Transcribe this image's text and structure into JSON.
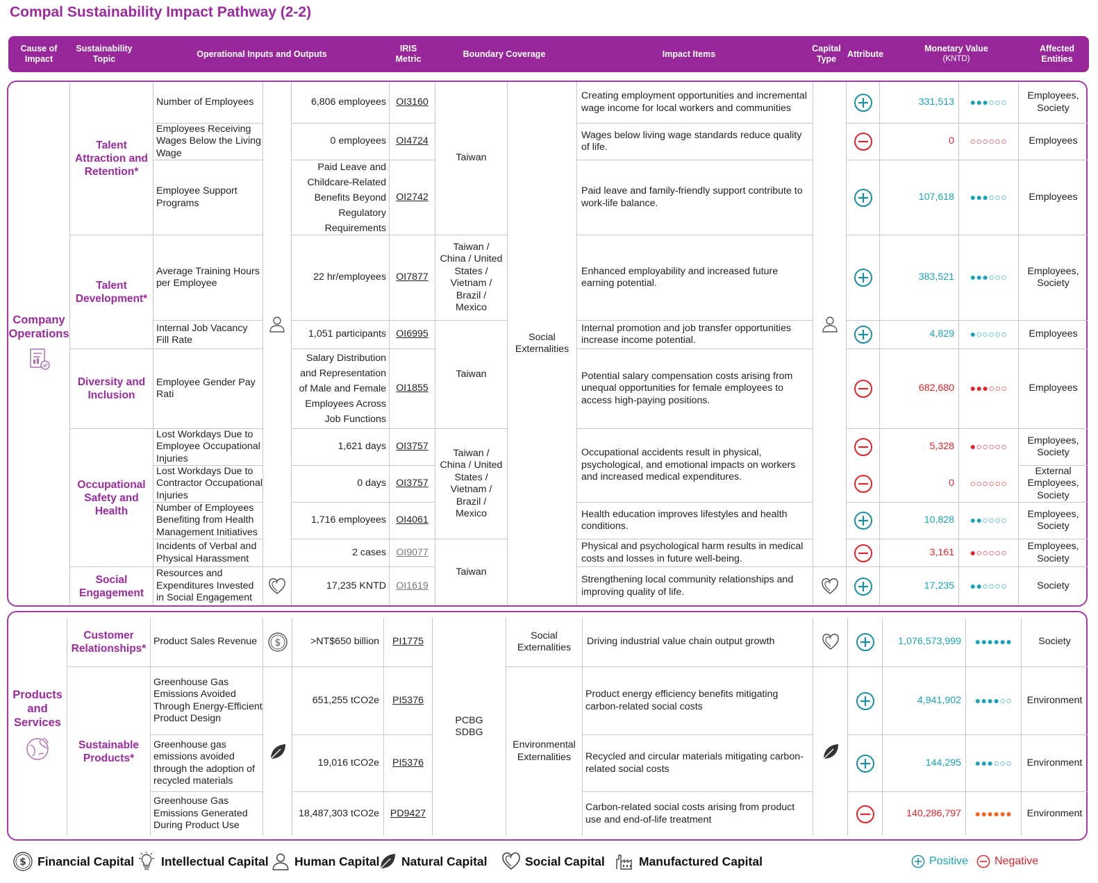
{
  "title": "Compal Sustainability Impact Pathway (2-2)",
  "header": {
    "cause": "Cause of Impact",
    "topic": "Sustainability Topic",
    "inputs": "Operational Inputs and Outputs",
    "iris": "IRIS Metric",
    "boundary": "Boundary Coverage",
    "impact": "Impact Items",
    "capital": "Capital Type",
    "attribute": "Attribute",
    "monetary": "Monetary Value",
    "monetary_unit": "(KNTD)",
    "affected": "Affected Entities"
  },
  "section1": {
    "cause": "Company Operations",
    "externality": "Social Externalities",
    "topics": {
      "talent": "Talent Attraction and Retention*",
      "development": "Talent Development*",
      "diversity": "Diversity and Inclusion",
      "safety": "Occupational Safety and Health",
      "social": "Social Engagement"
    },
    "boundaries": {
      "taiwan1": "Taiwan",
      "multi1": "Taiwan / China / United States / Vietnam / Brazil / Mexico",
      "taiwan2": "Taiwan",
      "multi2": "Taiwan / China / United States / Vietnam / Brazil / Mexico",
      "taiwan3": "Taiwan"
    },
    "rows": [
      {
        "metric": "Number of Employees",
        "value": "6,806 employees",
        "iris": "OI3160",
        "impact": "Creating employment opportunities and incremental wage income for local workers and communities",
        "money": "331,513",
        "dots": "●●●○○○",
        "affected": "Employees, Society"
      },
      {
        "metric": "Employees Receiving Wages Below the Living Wage",
        "value": "0 employees",
        "iris": "OI4724",
        "impact": "Wages below living wage standards reduce quality of life.",
        "money": "0",
        "dots": "○○○○○○",
        "affected": "Employees"
      },
      {
        "metric": "Employee Support Programs",
        "value": "Paid Leave and Childcare-Related Benefits Beyond Regulatory Requirements",
        "iris": "OI2742",
        "impact": "Paid leave and family-friendly support contribute to work-life balance.",
        "money": "107,618",
        "dots": "●●●○○○",
        "affected": "Employees"
      },
      {
        "metric": "Average Training Hours per Employee",
        "value": "22 hr/employees",
        "iris": "OI7877",
        "impact": "Enhanced employability and increased future earning potential.",
        "money": "383,521",
        "dots": "●●●○○○",
        "affected": "Employees, Society"
      },
      {
        "metric": "Internal Job Vacancy Fill Rate",
        "value": "1,051 participants",
        "iris": "OI6995",
        "impact": "Internal promotion and job transfer opportunities increase income potential.",
        "money": "4,829",
        "dots": "●○○○○○",
        "affected": "Employees"
      },
      {
        "metric": "Employee Gender Pay Rati",
        "value": "Salary Distribution and Representation of Male and Female Employees Across Job Functions",
        "iris": "OI1855",
        "impact": "Potential salary compensation costs arising from unequal opportunities for female employees to access high-paying positions.",
        "money": "682,680",
        "dots": "●●●○○○",
        "affected": "Employees"
      },
      {
        "metric": "Lost Workdays Due to Employee Occupational Injuries",
        "value": "1,621 days",
        "iris": "OI3757",
        "money": "5,328",
        "dots": "●○○○○○",
        "affected": "Employees, Society"
      },
      {
        "metric": "Lost Workdays Due to Contractor Occupational Injuries",
        "value": "0 days",
        "iris": "OI3757",
        "money": "0",
        "dots": "○○○○○○",
        "affected": "External Employees, Society"
      },
      {
        "metric": "Number of Employees Benefiting from Health Management Initiatives",
        "value": "1,716 employees",
        "iris": "OI4061",
        "impact": "Health education improves lifestyles and health conditions.",
        "money": "10,828",
        "dots": "●●○○○○",
        "affected": "Employees, Society"
      },
      {
        "metric": "Incidents of Verbal and Physical Harassment",
        "value": "2 cases",
        "iris": "OI9077",
        "impact": "Physical and psychological harm results in medical costs and losses in future well-being.",
        "money": "3,161",
        "dots": "●○○○○○",
        "affected": "Employees, Society"
      },
      {
        "metric": "Resources and Expenditures Invested in Social Engagement",
        "value": "17,235 KNTD",
        "iris": "OI1619",
        "impact": "Strengthening local community relationships and improving quality of life.",
        "money": "17,235",
        "dots": "●●○○○○",
        "affected": "Society"
      }
    ],
    "safety_impact": "Occupational accidents result in physical, psychological, and emotional impacts on workers and increased medical expenditures."
  },
  "section2": {
    "cause": "Products and Services",
    "boundary": "PCBG SDBG",
    "topics": {
      "customer": "Customer Relationships*",
      "sustainable": "Sustainable Products*"
    },
    "ext_social": "Social Externalities",
    "ext_env": "Environmental Externalities",
    "rows": [
      {
        "metric": "Product Sales Revenue",
        "value": ">NT$650 billion",
        "iris": "PI1775",
        "impact": "Driving industrial value chain output growth",
        "money": "1,076,573,999",
        "dots": "●●●●●●",
        "affected": "Society"
      },
      {
        "metric": "Greenhouse Gas Emissions Avoided Through Energy-Efficient Product Design",
        "value": "651,255 tCO2e",
        "iris": "PI5376",
        "impact": "Product energy efficiency benefits mitigating carbon-related social costs",
        "money": "4,941,902",
        "dots": "●●●●○○",
        "affected": "Environment"
      },
      {
        "metric": "Greenhouse gas emissions avoided through the adoption of recycled materials",
        "value": "19,016 tCO2e",
        "iris": "PI5376",
        "impact": "Recycled and circular materials mitigating carbon-related social costs",
        "money": "144,295",
        "dots": "●●●○○○",
        "affected": "Environment"
      },
      {
        "metric": "Greenhouse Gas Emissions Generated During Product Use",
        "value": "18,487,303 tCO2e",
        "iris": "PD9427",
        "impact": "Carbon-related social costs arising from product use and end-of-life treatment",
        "money": "140,286,797",
        "dots": "●●●●●●",
        "affected": "Environment"
      }
    ]
  },
  "legend": {
    "financial": "Financial Capital",
    "intellectual": "Intellectual Capital",
    "human": "Human Capital",
    "natural": "Natural Capital",
    "social": "Social Capital",
    "manufactured": "Manufactured Capital",
    "positive": "Positive",
    "negative": "Negative"
  }
}
